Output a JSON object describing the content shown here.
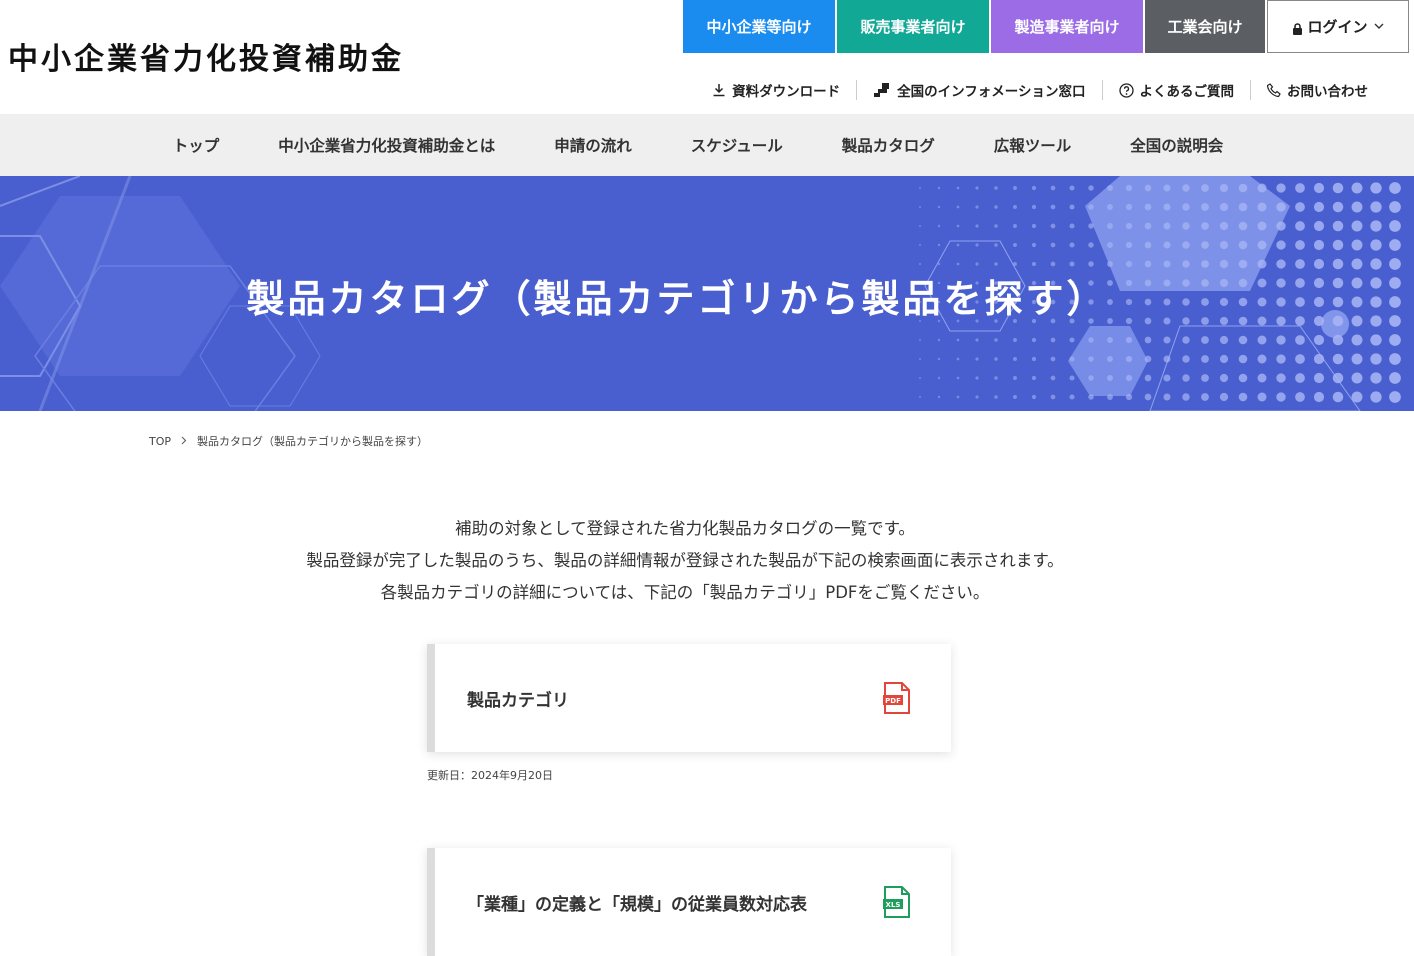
{
  "header": {
    "logo": "中小企業省力化投資補助金",
    "audience_tabs": [
      "中小企業等向け",
      "販売事業者向け",
      "製造事業者向け",
      "工業会向け"
    ],
    "login_label": "ログイン",
    "utility_links": [
      {
        "label": "資料ダウンロード",
        "icon": "download-icon"
      },
      {
        "label": "全国のインフォメーション窓口",
        "icon": "helpdesk-icon"
      },
      {
        "label": "よくあるご質問",
        "icon": "question-icon"
      },
      {
        "label": "お問い合わせ",
        "icon": "phone-icon"
      }
    ]
  },
  "gnav": {
    "items": [
      "トップ",
      "中小企業省力化投資補助金とは",
      "申請の流れ",
      "スケジュール",
      "製品カタログ",
      "広報ツール",
      "全国の説明会"
    ]
  },
  "hero": {
    "title": "製品カタログ（製品カテゴリから製品を探す）"
  },
  "breadcrumb": {
    "home": "TOP",
    "current": "製品カタログ（製品カテゴリから製品を探す）"
  },
  "intro": {
    "lines": [
      "補助の対象として登録された省力化製品カタログの一覧です。",
      "製品登録が完了した製品のうち、製品の詳細情報が登録された製品が下記の検索画面に表示されます。",
      "各製品カテゴリの詳細については、下記の「製品カテゴリ」PDFをご覧ください。"
    ]
  },
  "cards": [
    {
      "title": "製品カテゴリ",
      "icon": "pdf-file-icon",
      "icon_text": "PDF",
      "updated": "更新日：2024年9月20日"
    },
    {
      "title": "「業種」の定義と「規模」の従業員数対応表",
      "icon": "xls-file-icon",
      "icon_text": "XLS"
    }
  ],
  "colors": {
    "tab_sme": "#1a8cf0",
    "tab_sales": "#12a896",
    "tab_maker": "#9b6ce6",
    "tab_association": "#5b5f63",
    "hero_bg": "#4a5fcf",
    "pdf_red": "#e2463a",
    "xls_green": "#1f9d5a"
  }
}
